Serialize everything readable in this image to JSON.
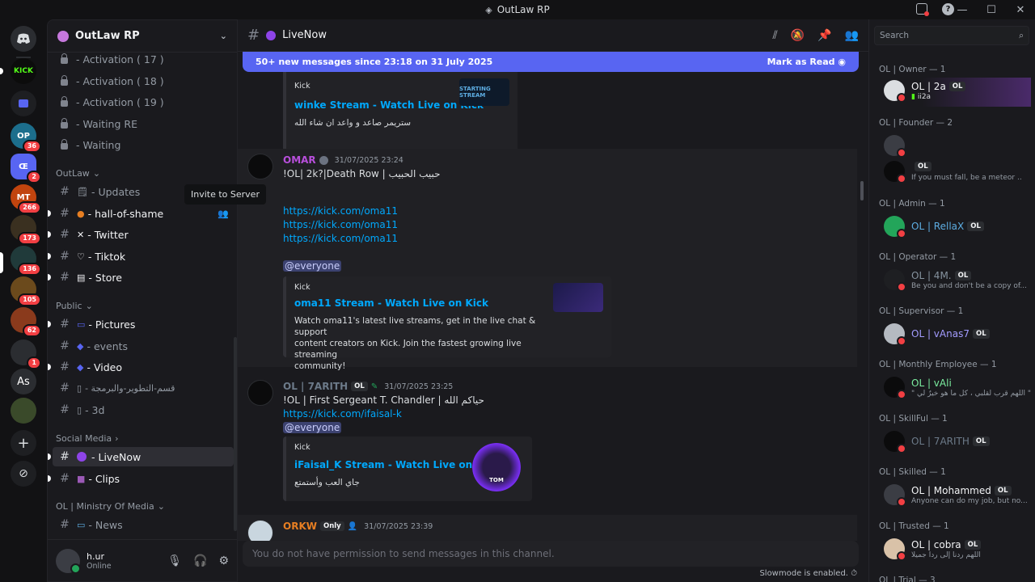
{
  "window": {
    "title": "OutLaw RP",
    "controls": [
      "—",
      "☐",
      "✕"
    ]
  },
  "rail": {
    "servers": [
      {
        "label": "",
        "badge": "",
        "color": "#2b2d31"
      },
      {
        "label": "KICK",
        "badge": "",
        "color": "#111"
      },
      {
        "label": "",
        "badge": "",
        "color": "#2b2d31"
      },
      {
        "label": "OP",
        "badge": "36",
        "color": "#1c6e8c"
      },
      {
        "label": "Œ",
        "badge": "2",
        "color": "#5865f2"
      },
      {
        "label": "MT",
        "badge": "266",
        "color": "#c1440e"
      },
      {
        "label": "",
        "badge": "173",
        "color": "#3a3020"
      },
      {
        "label": "",
        "badge": "136",
        "color": "#203a3a"
      },
      {
        "label": "",
        "badge": "105",
        "color": "#6b4a1c"
      },
      {
        "label": "",
        "badge": "62",
        "color": "#8a3a1c"
      },
      {
        "label": "",
        "badge": "1",
        "color": "#2b2d31"
      },
      {
        "label": "As",
        "badge": "",
        "color": "#2b2d31"
      },
      {
        "label": "",
        "badge": "",
        "color": "#3a4a2a"
      }
    ]
  },
  "sidebar": {
    "guild_name": "OutLaw RP",
    "locked": [
      "- Activation ( 17 )",
      "- Activation ( 18 )",
      "- Activation ( 19 )",
      "- Waiting RE",
      "- Waiting"
    ],
    "cat_outlaw": "OutLaw",
    "ch_updates": "- Updates",
    "ch_hall": "- hall-of-shame",
    "ch_twitter": "- Twitter",
    "ch_tiktok": "- Tiktok",
    "ch_store": "- Store",
    "cat_public": "Public",
    "ch_pictures": "- Pictures",
    "ch_events": "- events",
    "ch_video": "- Video",
    "ch_dev": "- قسم-التطوير-والبرمجة",
    "ch_3d": "- 3d",
    "cat_social": "Social Media",
    "ch_livenow": "- LiveNow",
    "ch_clips": "- Clips",
    "cat_ministry": "OL | Ministry Of Media",
    "ch_news": "- News",
    "tooltip": "Invite to Server"
  },
  "user": {
    "name": "h.ur",
    "status": "Online"
  },
  "chat": {
    "channel": "LiveNow",
    "banner": "50+ new messages since 23:18 on 31 July 2025",
    "mark_read": "Mark as Read",
    "embed1": {
      "provider": "Kick",
      "title": "winke Stream - Watch Live on Kick",
      "desc": "ستريمر صاعد و واعد ان شاء الله",
      "thumb_text": "STARTING STREAM"
    },
    "msg_omar": {
      "author": "OMAR",
      "time": "31/07/2025 23:24",
      "line1": "!OL| 2k?|Death Row | حبيب الحبيب",
      "links": [
        "https://kick.com/oma11",
        "https://kick.com/oma11",
        "https://kick.com/oma11"
      ],
      "mention": "@everyone",
      "embed": {
        "provider": "Kick",
        "title": "oma11 Stream - Watch Live on Kick",
        "desc": [
          "Watch oma11's latest live streams, get in the live chat & support",
          "content creators on Kick. Join the fastest growing live streaming",
          "community!"
        ]
      }
    },
    "msg_tarith": {
      "author": "OL | 7ARITH",
      "tag": "OL",
      "time": "31/07/2025 23:25",
      "line1": "!OL | First Sergeant T. Chandler | حياكم الله",
      "link": "https://kick.com/ifaisal-k",
      "mention": "@everyone",
      "embed": {
        "provider": "Kick",
        "title": "iFaisal_K Stream - Watch Live on Kick",
        "desc": "جاي العب وأستمتع",
        "thumb_text": "TOM"
      }
    },
    "msg_orkw": {
      "author": "ORKW",
      "tag": "Only",
      "time": "31/07/2025 23:39"
    },
    "input_placeholder": "You do not have permission to send messages in this channel.",
    "slowmode": "Slowmode is enabled."
  },
  "members": {
    "search_placeholder": "Search",
    "groups": [
      {
        "role": "OL | Owner — 1",
        "name": "OL | 2a",
        "tag": "OL",
        "status": "ii2a",
        "color": "#f2f3f5"
      },
      {
        "role": "OL | Founder — 2",
        "name": "",
        "tag": "",
        "status": "",
        "color": "#c0392b"
      },
      {
        "role": "",
        "name": "",
        "tag": "OL",
        "status": "If you must fall, be a meteor ..",
        "color": "#c0392b"
      },
      {
        "role": "OL | Admin — 1",
        "name": "OL | RellaX",
        "tag": "OL",
        "status": "",
        "color": "#5dade2"
      },
      {
        "role": "OL | Operator — 1",
        "name": "OL | 4M.",
        "tag": "OL",
        "status": "Be you and don't be a copy of...",
        "color": "#85929e"
      },
      {
        "role": "OL | Supervisor — 1",
        "name": "OL | vAnas7",
        "tag": "OL",
        "status": "",
        "color": "#a29bfe"
      },
      {
        "role": "OL | Monthly Employee — 1",
        "name": "OL | vAli",
        "tag": "",
        "status": "\" اللهم قرب لقلبي ، كل ما هو خيرٌ لي \"",
        "color": "#7bed9f"
      },
      {
        "role": "OL | SkillFul — 1",
        "name": "OL | 7ARITH",
        "tag": "OL",
        "status": "",
        "color": "#6c7a89"
      },
      {
        "role": "OL | Skilled — 1",
        "name": "OL | Mohammed",
        "tag": "OL",
        "status": "Anyone can do my job, but no...",
        "color": "#f2f3f5"
      },
      {
        "role": "OL | Trusted — 1",
        "name": "OL | cobra",
        "tag": "OL",
        "status": "اللهم ردنا إلى ردا جميلا",
        "color": "#f2f3f5"
      },
      {
        "role": "OL | Trial — 3",
        "name": "",
        "tag": "",
        "status": "",
        "color": "#f2f3f5"
      }
    ]
  },
  "colors": {
    "accent": "#5865f2",
    "link": "#00a8fc",
    "live_dot": "#8e44e8",
    "dnd": "#f23f43",
    "online": "#23a55a"
  }
}
